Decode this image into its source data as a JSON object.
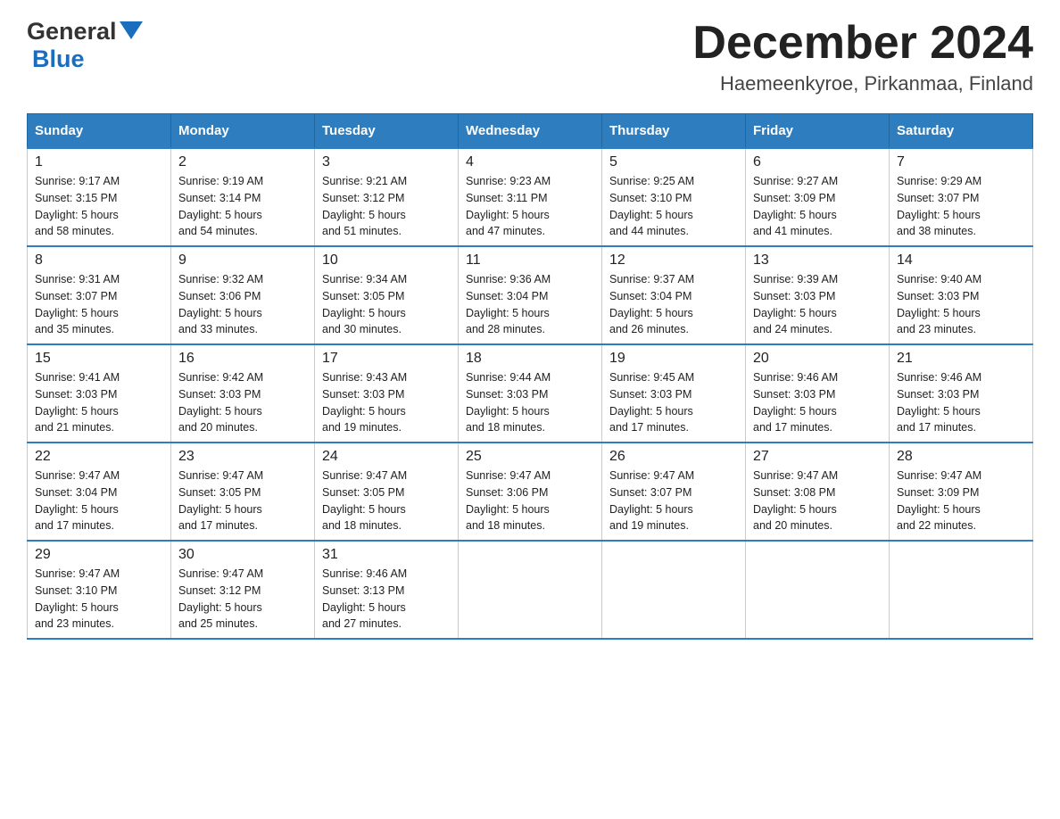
{
  "header": {
    "logo_general": "General",
    "logo_blue": "Blue",
    "month_title": "December 2024",
    "location": "Haemeenkyroe, Pirkanmaa, Finland"
  },
  "weekdays": [
    "Sunday",
    "Monday",
    "Tuesday",
    "Wednesday",
    "Thursday",
    "Friday",
    "Saturday"
  ],
  "weeks": [
    [
      {
        "day": "1",
        "sunrise": "9:17 AM",
        "sunset": "3:15 PM",
        "daylight": "5 hours and 58 minutes."
      },
      {
        "day": "2",
        "sunrise": "9:19 AM",
        "sunset": "3:14 PM",
        "daylight": "5 hours and 54 minutes."
      },
      {
        "day": "3",
        "sunrise": "9:21 AM",
        "sunset": "3:12 PM",
        "daylight": "5 hours and 51 minutes."
      },
      {
        "day": "4",
        "sunrise": "9:23 AM",
        "sunset": "3:11 PM",
        "daylight": "5 hours and 47 minutes."
      },
      {
        "day": "5",
        "sunrise": "9:25 AM",
        "sunset": "3:10 PM",
        "daylight": "5 hours and 44 minutes."
      },
      {
        "day": "6",
        "sunrise": "9:27 AM",
        "sunset": "3:09 PM",
        "daylight": "5 hours and 41 minutes."
      },
      {
        "day": "7",
        "sunrise": "9:29 AM",
        "sunset": "3:07 PM",
        "daylight": "5 hours and 38 minutes."
      }
    ],
    [
      {
        "day": "8",
        "sunrise": "9:31 AM",
        "sunset": "3:07 PM",
        "daylight": "5 hours and 35 minutes."
      },
      {
        "day": "9",
        "sunrise": "9:32 AM",
        "sunset": "3:06 PM",
        "daylight": "5 hours and 33 minutes."
      },
      {
        "day": "10",
        "sunrise": "9:34 AM",
        "sunset": "3:05 PM",
        "daylight": "5 hours and 30 minutes."
      },
      {
        "day": "11",
        "sunrise": "9:36 AM",
        "sunset": "3:04 PM",
        "daylight": "5 hours and 28 minutes."
      },
      {
        "day": "12",
        "sunrise": "9:37 AM",
        "sunset": "3:04 PM",
        "daylight": "5 hours and 26 minutes."
      },
      {
        "day": "13",
        "sunrise": "9:39 AM",
        "sunset": "3:03 PM",
        "daylight": "5 hours and 24 minutes."
      },
      {
        "day": "14",
        "sunrise": "9:40 AM",
        "sunset": "3:03 PM",
        "daylight": "5 hours and 23 minutes."
      }
    ],
    [
      {
        "day": "15",
        "sunrise": "9:41 AM",
        "sunset": "3:03 PM",
        "daylight": "5 hours and 21 minutes."
      },
      {
        "day": "16",
        "sunrise": "9:42 AM",
        "sunset": "3:03 PM",
        "daylight": "5 hours and 20 minutes."
      },
      {
        "day": "17",
        "sunrise": "9:43 AM",
        "sunset": "3:03 PM",
        "daylight": "5 hours and 19 minutes."
      },
      {
        "day": "18",
        "sunrise": "9:44 AM",
        "sunset": "3:03 PM",
        "daylight": "5 hours and 18 minutes."
      },
      {
        "day": "19",
        "sunrise": "9:45 AM",
        "sunset": "3:03 PM",
        "daylight": "5 hours and 17 minutes."
      },
      {
        "day": "20",
        "sunrise": "9:46 AM",
        "sunset": "3:03 PM",
        "daylight": "5 hours and 17 minutes."
      },
      {
        "day": "21",
        "sunrise": "9:46 AM",
        "sunset": "3:03 PM",
        "daylight": "5 hours and 17 minutes."
      }
    ],
    [
      {
        "day": "22",
        "sunrise": "9:47 AM",
        "sunset": "3:04 PM",
        "daylight": "5 hours and 17 minutes."
      },
      {
        "day": "23",
        "sunrise": "9:47 AM",
        "sunset": "3:05 PM",
        "daylight": "5 hours and 17 minutes."
      },
      {
        "day": "24",
        "sunrise": "9:47 AM",
        "sunset": "3:05 PM",
        "daylight": "5 hours and 18 minutes."
      },
      {
        "day": "25",
        "sunrise": "9:47 AM",
        "sunset": "3:06 PM",
        "daylight": "5 hours and 18 minutes."
      },
      {
        "day": "26",
        "sunrise": "9:47 AM",
        "sunset": "3:07 PM",
        "daylight": "5 hours and 19 minutes."
      },
      {
        "day": "27",
        "sunrise": "9:47 AM",
        "sunset": "3:08 PM",
        "daylight": "5 hours and 20 minutes."
      },
      {
        "day": "28",
        "sunrise": "9:47 AM",
        "sunset": "3:09 PM",
        "daylight": "5 hours and 22 minutes."
      }
    ],
    [
      {
        "day": "29",
        "sunrise": "9:47 AM",
        "sunset": "3:10 PM",
        "daylight": "5 hours and 23 minutes."
      },
      {
        "day": "30",
        "sunrise": "9:47 AM",
        "sunset": "3:12 PM",
        "daylight": "5 hours and 25 minutes."
      },
      {
        "day": "31",
        "sunrise": "9:46 AM",
        "sunset": "3:13 PM",
        "daylight": "5 hours and 27 minutes."
      },
      null,
      null,
      null,
      null
    ]
  ],
  "labels": {
    "sunrise": "Sunrise:",
    "sunset": "Sunset:",
    "daylight": "Daylight:"
  }
}
